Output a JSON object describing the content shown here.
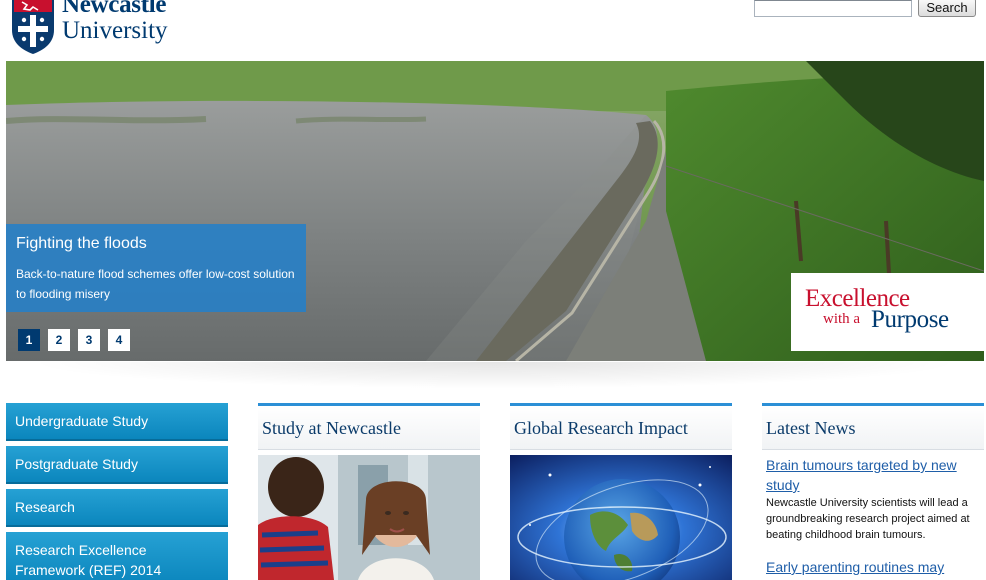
{
  "header": {
    "logo_line1": "Newcastle",
    "logo_line2": "University",
    "search_placeholder": "",
    "search_button": "Search"
  },
  "hero": {
    "title": "Fighting the floods",
    "text": "Back-to-nature flood schemes offer low-cost solution to flooding misery",
    "pages": [
      "1",
      "2",
      "3",
      "4"
    ],
    "active_page": "1",
    "badge_line1": "Excellence",
    "badge_line2": "with a",
    "badge_line3": "Purpose"
  },
  "nav": {
    "items": [
      {
        "label": "Undergraduate Study"
      },
      {
        "label": "Postgraduate Study"
      },
      {
        "label": "Research"
      },
      {
        "label": "Research Excellence Framework (REF) 2014"
      }
    ]
  },
  "columns": {
    "study": {
      "title": "Study at Newcastle"
    },
    "research": {
      "title": "Global Research Impact"
    },
    "news": {
      "title": "Latest News",
      "items": [
        {
          "link": "Brain tumours targeted by new study",
          "desc": "Newcastle University scientists will lead a groundbreaking research project aimed at beating childhood brain tumours."
        },
        {
          "link": "Early parenting routines may",
          "desc": ""
        }
      ]
    }
  },
  "colors": {
    "brand_navy": "#003a70",
    "brand_red": "#c8102e",
    "nav_blue": "#1596c9",
    "caption_blue": "#2480c8",
    "link_blue": "#1f5ea8"
  }
}
